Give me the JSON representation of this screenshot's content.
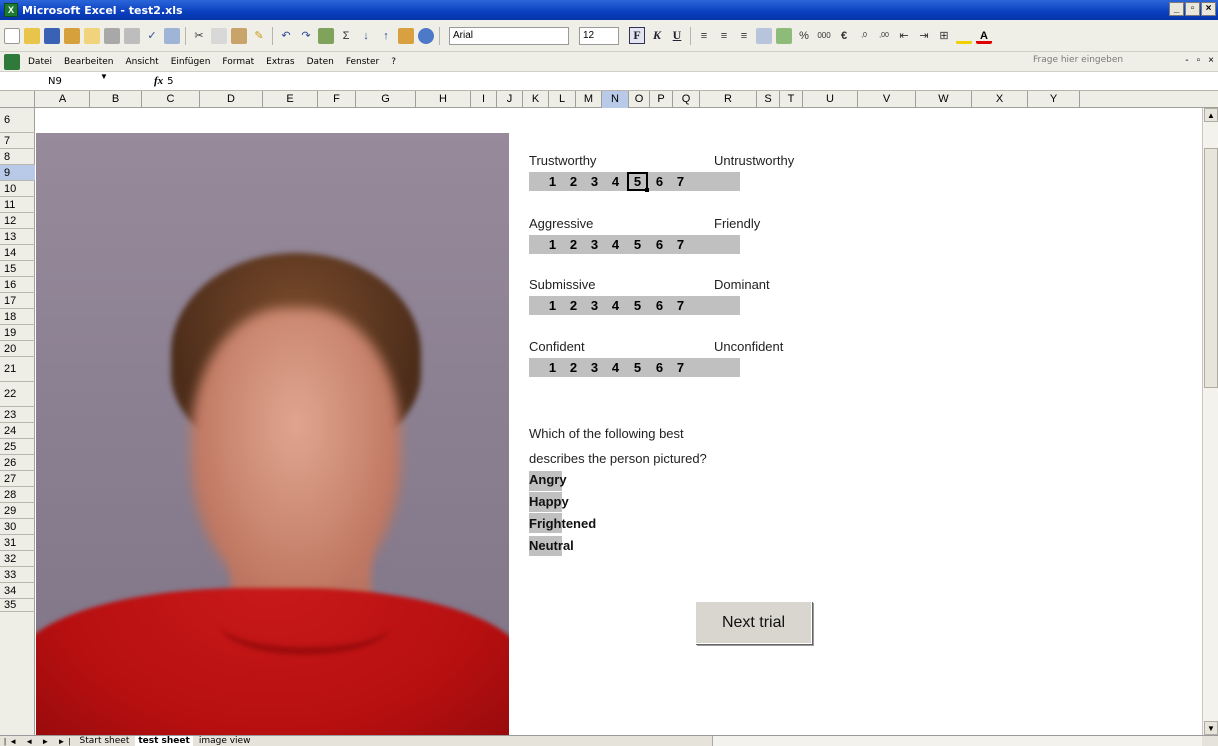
{
  "window": {
    "title": "Microsoft Excel - test2.xls",
    "controls": [
      "_",
      "▫",
      "×"
    ]
  },
  "toolbar": {
    "font": "Arial",
    "size": "12"
  },
  "menu": {
    "items": [
      "Datei",
      "Bearbeiten",
      "Ansicht",
      "Einfügen",
      "Format",
      "Extras",
      "Daten",
      "Fenster",
      "?"
    ],
    "help_placeholder": "Frage hier eingeben"
  },
  "formula": {
    "cell": "N9",
    "value": "5"
  },
  "columns": [
    "A",
    "B",
    "C",
    "D",
    "E",
    "F",
    "G",
    "H",
    "I",
    "J",
    "K",
    "L",
    "M",
    "N",
    "O",
    "P",
    "Q",
    "R",
    "S",
    "T",
    "U",
    "V",
    "W",
    "X",
    "Y"
  ],
  "rows": [
    "6",
    "7",
    "8",
    "9",
    "10",
    "11",
    "12",
    "13",
    "14",
    "15",
    "16",
    "17",
    "18",
    "19",
    "20",
    "21",
    "22",
    "23",
    "24",
    "25",
    "26",
    "27",
    "28",
    "29",
    "30",
    "31",
    "32",
    "33",
    "34",
    "35"
  ],
  "scales": [
    {
      "left": "Trustworthy",
      "right": "Untrustworthy",
      "values": [
        "1",
        "2",
        "3",
        "4",
        "5",
        "6",
        "7"
      ],
      "selected": 5
    },
    {
      "left": "Aggressive",
      "right": "Friendly",
      "values": [
        "1",
        "2",
        "3",
        "4",
        "5",
        "6",
        "7"
      ],
      "selected": null
    },
    {
      "left": "Submissive",
      "right": "Dominant",
      "values": [
        "1",
        "2",
        "3",
        "4",
        "5",
        "6",
        "7"
      ],
      "selected": null
    },
    {
      "left": "Confident",
      "right": "Unconfident",
      "values": [
        "1",
        "2",
        "3",
        "4",
        "5",
        "6",
        "7"
      ],
      "selected": null
    }
  ],
  "question": {
    "line1": "Which of the following best",
    "line2": "describes the person pictured?",
    "options": [
      "Angry",
      "Happy",
      "Frightened",
      "Neutral"
    ]
  },
  "next_button": "Next trial",
  "sheets": {
    "nav": "|◄ ◄ ► ►|",
    "tabs": [
      "Start sheet",
      "test sheet",
      "image view"
    ],
    "active": "test sheet"
  }
}
